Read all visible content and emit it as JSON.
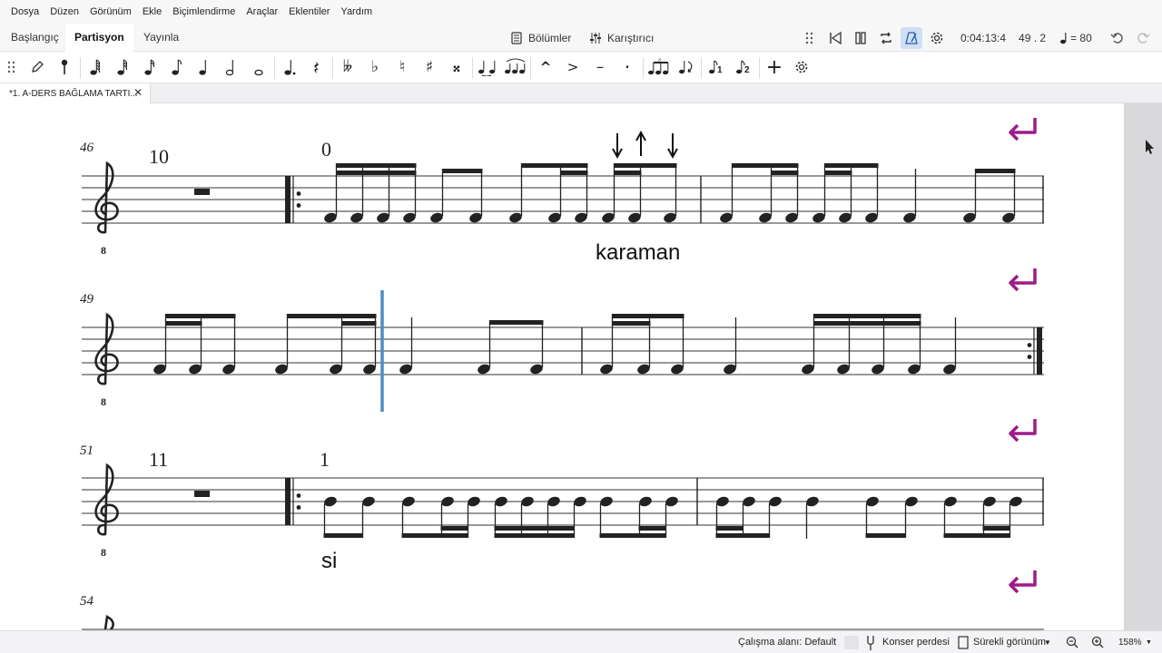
{
  "menu": [
    "Dosya",
    "Düzen",
    "Görünüm",
    "Ekle",
    "Biçimlendirme",
    "Araçlar",
    "Eklentiler",
    "Yardım"
  ],
  "workspace_tabs": [
    "Başlangıç",
    "Partisyon",
    "Yayınla"
  ],
  "active_workspace_tab": "Partisyon",
  "toolbar_center": {
    "parts_label": "Bölümler",
    "mixer_label": "Karıştırıcı"
  },
  "playback": {
    "time": "0:04:13:4",
    "position": "49 . 2",
    "tempo": "= 80"
  },
  "document_tab": {
    "title": "*1. A-DERS BAĞLAMA TARTI...",
    "close": "✕"
  },
  "score": {
    "systems": [
      {
        "measure_number": "46",
        "rest_count": "10",
        "rehearsal_mark": "0",
        "lyric": "karaman"
      },
      {
        "measure_number": "49"
      },
      {
        "measure_number": "51",
        "rest_count": "11",
        "rehearsal_mark": "1",
        "lyric": "si"
      },
      {
        "measure_number": "54"
      }
    ],
    "clef_subscript": "8",
    "accent_color": "#9c1c88",
    "cursor_color": "#4a8fc2"
  },
  "status": {
    "workspace": "Çalışma alanı: Default",
    "concert_pitch": "Konser perdesi",
    "view_mode": "Sürekli görünüm",
    "zoom": "158%"
  },
  "icons": {
    "note_input": "pencil-icon",
    "undo": "undo-icon",
    "redo": "redo-icon",
    "settings": "gear-icon"
  }
}
